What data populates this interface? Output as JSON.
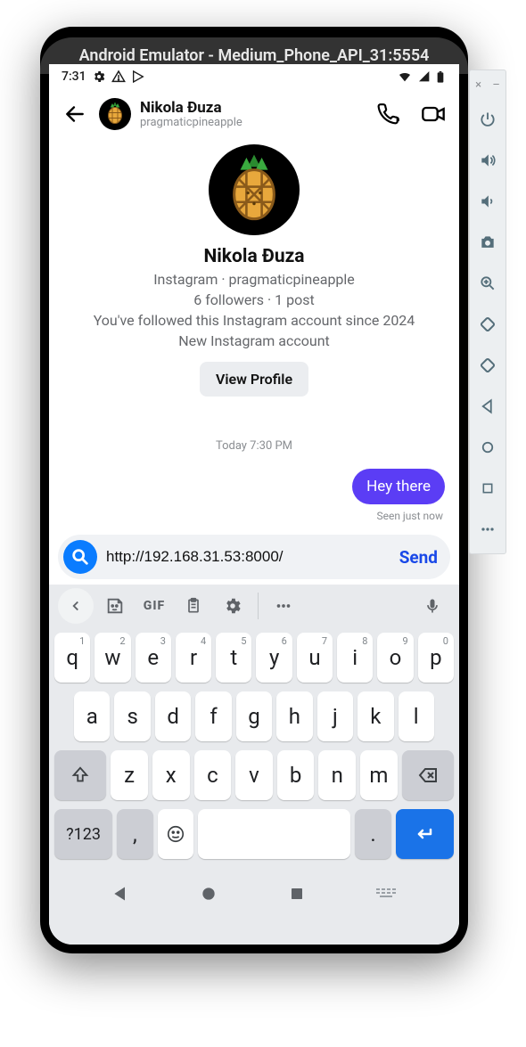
{
  "emulator": {
    "title": "Android Emulator - Medium_Phone_API_31:5554"
  },
  "status_bar": {
    "time": "7:31"
  },
  "header": {
    "name": "Nikola Đuza",
    "username": "pragmaticpineapple"
  },
  "profile": {
    "name": "Nikola Đuza",
    "subtitle": "Instagram · pragmaticpineapple",
    "followers_posts": "6 followers · 1 post",
    "followed_since": "You've followed this Instagram account since 2024",
    "new_account": "New Instagram account",
    "view_profile_label": "View Profile"
  },
  "timestamp": "Today 7:30 PM",
  "message": {
    "text": "Hey there",
    "seen": "Seen just now"
  },
  "composer": {
    "value": "http://192.168.31.53:8000/",
    "send_label": "Send"
  },
  "keyboard": {
    "gif_label": "GIF",
    "row1": [
      "q",
      "w",
      "e",
      "r",
      "t",
      "y",
      "u",
      "i",
      "o",
      "p"
    ],
    "row1_sup": [
      "1",
      "2",
      "3",
      "4",
      "5",
      "6",
      "7",
      "8",
      "9",
      "0"
    ],
    "row2": [
      "a",
      "s",
      "d",
      "f",
      "g",
      "h",
      "j",
      "k",
      "l"
    ],
    "row3": [
      "z",
      "x",
      "c",
      "v",
      "b",
      "n",
      "m"
    ],
    "symbols_label": "?123",
    "comma_label": ",",
    "period_label": "."
  }
}
